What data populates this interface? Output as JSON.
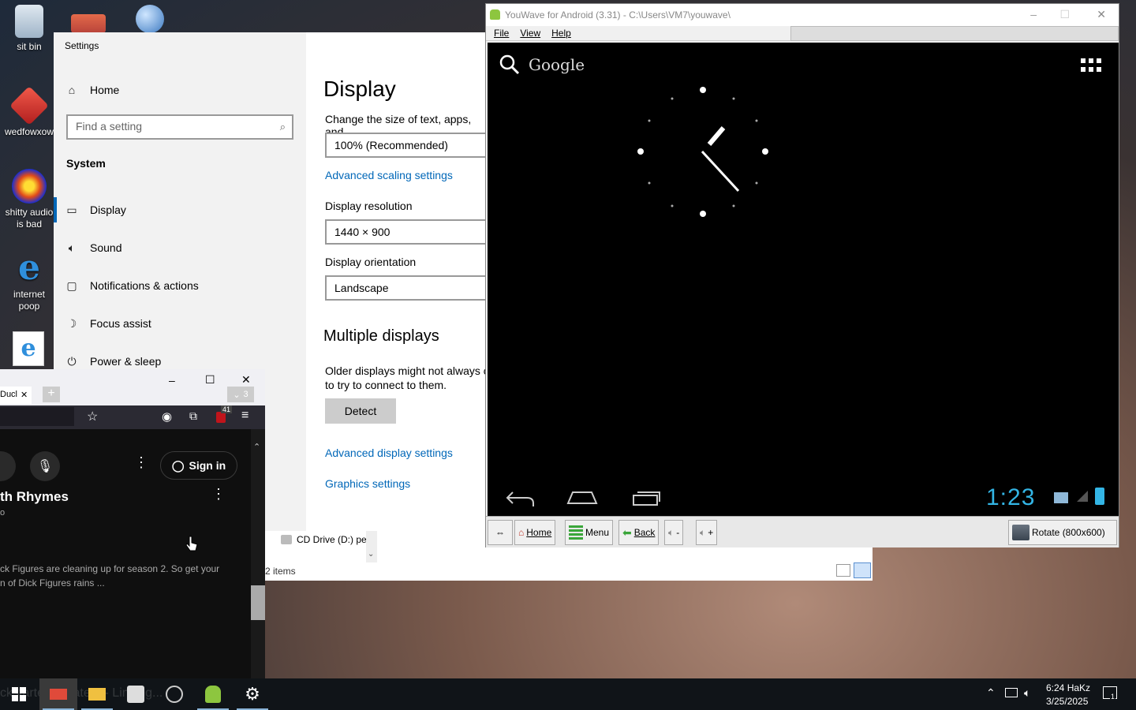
{
  "desktop": {
    "icons": [
      {
        "label": "sit bin"
      },
      {
        "label": "wedfowxow"
      },
      {
        "label": "shitty audio is bad"
      },
      {
        "label": "internet poop"
      }
    ]
  },
  "settings": {
    "window_title": "Settings",
    "home": "Home",
    "search_placeholder": "Find a setting",
    "section": "System",
    "nav": [
      "Display",
      "Sound",
      "Notifications & actions",
      "Focus assist",
      "Power & sleep"
    ],
    "page_title": "Display",
    "scale_label": "Change the size of text, apps, and",
    "scale_value": "100% (Recommended)",
    "advanced_scaling": "Advanced scaling settings",
    "resolution_label": "Display resolution",
    "resolution_value": "1440 × 900",
    "orientation_label": "Display orientation",
    "orientation_value": "Landscape",
    "multiple_heading": "Multiple displays",
    "multiple_text_1": "Older displays might not always c",
    "multiple_text_2": "to try to connect to them.",
    "detect_button": "Detect",
    "advanced_display": "Advanced display settings",
    "graphics": "Graphics settings"
  },
  "youwave": {
    "title": "YouWave for Android (3.31) - C:\\Users\\VM7\\youwave\\",
    "menu": [
      "File",
      "View",
      "Help"
    ],
    "google_label": "Google",
    "clock_time": "1:23",
    "toolbar": {
      "home": "Home",
      "menu": "Menu",
      "back": "Back",
      "vol_down": "-",
      "vol_up": "+",
      "rotate": "Rotate (800x600)"
    }
  },
  "browser": {
    "tab_label": "Ducl",
    "tab_count": "3",
    "badge": "41",
    "sign_in": "Sign in",
    "video_title": "th Rhymes",
    "sub_text": "o",
    "desc_1": "ck Figures are cleaning up for season 2. So get your",
    "desc_2": "n of Dick Figures rains ..."
  },
  "explorer": {
    "drive_label": "CD Drive (D:) pe",
    "item_count": "2 items"
  },
  "taskbar": {
    "time": "6:24 HaKz",
    "date": "3/25/2025",
    "notif_count": "1",
    "ghost_text": "ckstarter update 3 - Linking..."
  },
  "colors": {
    "accent": "#0067b8",
    "taskbar": "#101418",
    "clock_blue": "#33b5e5"
  }
}
